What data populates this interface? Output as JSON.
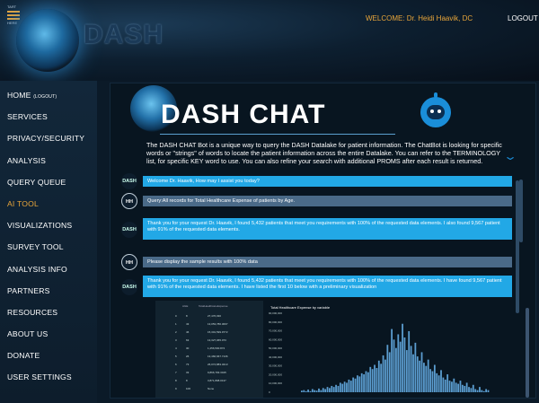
{
  "header": {
    "menu_label_top": "TART",
    "menu_label_bottom": "HERE",
    "logo_text": "DASH",
    "welcome": "WELCOME: Dr. Heidi Haavik, DC",
    "logout": "LOGOUT"
  },
  "sidebar": {
    "items": [
      {
        "label": "HOME",
        "suffix": "(LOGOUT)"
      },
      {
        "label": "SERVICES"
      },
      {
        "label": "PRIVACY/SECURITY"
      },
      {
        "label": "ANALYSIS"
      },
      {
        "label": "QUERY QUEUE"
      },
      {
        "label": "AI TOOL",
        "active": true
      },
      {
        "label": "VISUALIZATIONS"
      },
      {
        "label": "SURVEY TOOL"
      },
      {
        "label": "ANALYSIS INFO"
      },
      {
        "label": "PARTNERS"
      },
      {
        "label": "RESOURCES"
      },
      {
        "label": "ABOUT US"
      },
      {
        "label": "DONATE"
      },
      {
        "label": "USER SETTINGS"
      }
    ]
  },
  "chat": {
    "title": "DASH CHAT",
    "intro": "The DASH CHAT Bot is a unique way to query the DASH Datalake for patient information. The ChatBot is looking for specific words or \"strings\" of words to locate the patient information across the entire Datalake. You can refer to the TERMINOLOGY list, for specific KEY word to use. You can also refine your search with additional PROMS after each result is returned.",
    "messages": [
      {
        "sender": "DASH",
        "text": "Welcome Dr. Haavik, How may I assist you today?"
      },
      {
        "sender": "HH",
        "text": "Query:All records for Total Healthcare Expense of patients by Age."
      },
      {
        "sender": "DASH",
        "text": "Thank you for your request Dr. Haavik, I found 5,432 patients that meet you requirements with 100% of the requested data elements.  I also found 9,567 patient with 91% of the requested data elements."
      },
      {
        "sender": "HH",
        "text": "Please display the sample results with 100% data"
      },
      {
        "sender": "DASH",
        "text": "Thank you for your request Dr. Haavik, I found 5,432 patients that meet you requirements with 100% of the requested data elements.  I have found 9,567 patient with 91% of the requested data elements. I have listed the first 10 below with a preliminary visualization"
      }
    ]
  },
  "table": {
    "headers": [
      "AGE",
      "TotalHealthcareExpense"
    ],
    "rows": [
      [
        "0",
        "8",
        "27,476,030"
      ],
      [
        "1",
        "43",
        "13,053,786.3097"
      ],
      [
        "2",
        "46",
        "15,301,599.9772"
      ],
      [
        "3",
        "63",
        "13,327,065.073"
      ],
      [
        "4",
        "30",
        "1,256,530.874"
      ],
      [
        "5",
        "26",
        "13,466,667.7136"
      ],
      [
        "6",
        "73",
        "26,074,883.3213"
      ],
      [
        "7",
        "33",
        "9,866,793.3015"
      ],
      [
        "8",
        "8",
        "3,871,808.0137"
      ],
      [
        "9",
        "106",
        "None"
      ]
    ]
  },
  "chart_data": {
    "type": "bar",
    "title": "Total Healthcare Expense by variable",
    "xlabel": "",
    "ylabel": "",
    "y_tick_labels": [
      "90,000,000",
      "80,000,000",
      "70,000,000",
      "60,000,000",
      "50,000,000",
      "40,000,000",
      "30,000,000",
      "20,000,000",
      "10,000,000",
      "0"
    ],
    "ylim": [
      0,
      90000000
    ],
    "values": [
      1.5,
      2,
      1,
      2.5,
      1,
      3,
      2,
      1.5,
      3.5,
      2,
      4,
      3,
      5,
      4,
      6,
      5,
      7,
      6,
      9,
      8,
      10,
      9,
      12,
      11,
      14,
      13,
      16,
      15,
      18,
      17,
      20,
      19,
      24,
      22,
      26,
      23,
      30,
      27,
      35,
      31,
      45,
      38,
      60,
      50,
      42,
      55,
      48,
      65,
      52,
      40,
      58,
      44,
      36,
      47,
      34,
      30,
      38,
      28,
      25,
      31,
      22,
      20,
      26,
      18,
      16,
      21,
      14,
      12,
      17,
      11,
      10,
      13,
      9,
      8,
      11,
      7,
      6,
      9,
      5,
      4,
      7,
      3,
      2,
      5,
      2,
      1,
      3,
      2
    ]
  },
  "colors": {
    "accent": "#e8a53a",
    "bot_bubble": "#22a8e6",
    "user_bubble": "#4a6a88",
    "bar": "#5b9dd0"
  }
}
